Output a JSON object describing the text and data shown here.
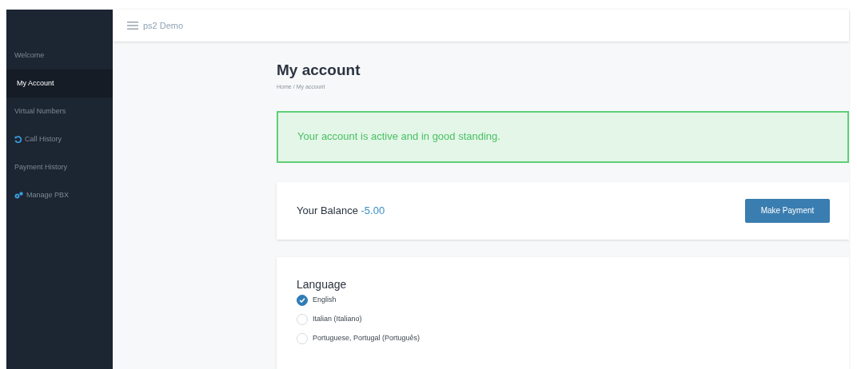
{
  "topbar": {
    "title": "ps2 Demo"
  },
  "sidebar": {
    "items": [
      {
        "label": "Welcome",
        "selected": false
      },
      {
        "label": "My Account",
        "selected": true
      },
      {
        "label": "Virtual Numbers",
        "selected": false
      },
      {
        "label": "Call History",
        "selected": false
      },
      {
        "label": "Payment History",
        "selected": false
      },
      {
        "label": "Manage PBX",
        "selected": false
      }
    ]
  },
  "page": {
    "title": "My account",
    "breadcrumb": [
      "Home",
      "/",
      "My account"
    ]
  },
  "alert": {
    "text": "Your account is active and in good standing."
  },
  "balance": {
    "label": "Your Balance",
    "amount": "-5.00",
    "button": "Make Payment"
  },
  "language": {
    "title": "Language",
    "options": [
      {
        "label": "English",
        "selected": true
      },
      {
        "label": "Italian (Italiano)",
        "selected": false
      },
      {
        "label": "Portuguese, Portugal (Português)",
        "selected": false
      }
    ]
  }
}
